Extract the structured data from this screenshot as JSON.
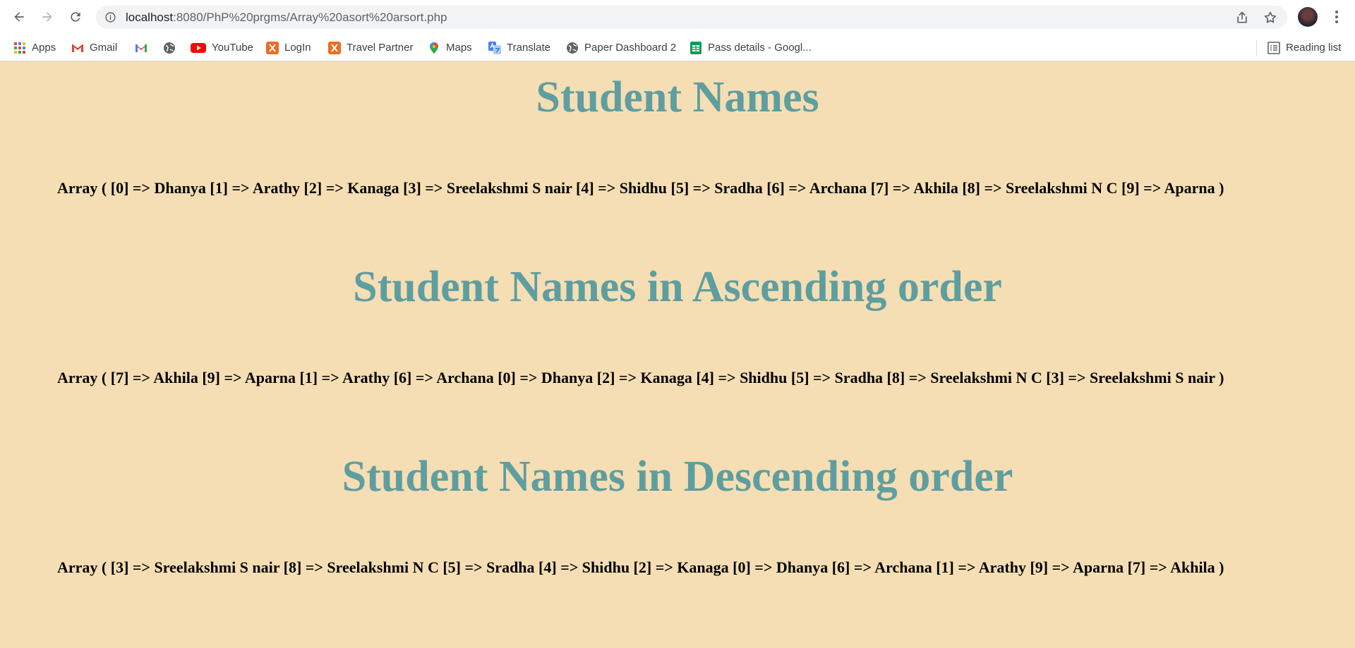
{
  "browser": {
    "url_host": "localhost",
    "url_rest": ":8080/PhP%20prgms/Array%20asort%20arsort.php",
    "bookmarks": [
      {
        "label": "Apps",
        "icon": "apps-grid-icon"
      },
      {
        "label": "Gmail",
        "icon": "gmail-icon"
      },
      {
        "label": "",
        "icon": "gmail-icon"
      },
      {
        "label": "",
        "icon": "globe-icon"
      },
      {
        "label": "YouTube",
        "icon": "youtube-icon"
      },
      {
        "label": "LogIn",
        "icon": "xampp-icon"
      },
      {
        "label": "Travel Partner",
        "icon": "xampp-icon"
      },
      {
        "label": "Maps",
        "icon": "maps-pin-icon"
      },
      {
        "label": "Translate",
        "icon": "translate-icon"
      },
      {
        "label": "Paper Dashboard 2",
        "icon": "globe-icon"
      },
      {
        "label": "Pass details - Googl...",
        "icon": "sheets-icon"
      }
    ],
    "reading_list": "Reading list"
  },
  "content": {
    "heading1": "Student Names",
    "array1": "Array ( [0] => Dhanya [1] => Arathy [2] => Kanaga [3] => Sreelakshmi S nair [4] => Shidhu [5] => Sradha [6] => Archana [7] => Akhila [8] => Sreelakshmi N C [9] => Aparna )",
    "heading2": "Student Names in Ascending order",
    "array2": "Array ( [7] => Akhila [9] => Aparna [1] => Arathy [6] => Archana [0] => Dhanya [2] => Kanaga [4] => Shidhu [5] => Sradha [8] => Sreelakshmi N C [3] => Sreelakshmi S nair )",
    "heading3": "Student Names in Descending order",
    "array3": "Array ( [3] => Sreelakshmi S nair [8] => Sreelakshmi N C [5] => Sradha [4] => Shidhu [2] => Kanaga [0] => Dhanya [6] => Archana [1] => Arathy [9] => Aparna [7] => Akhila )"
  },
  "colors": {
    "page_background": "#f5deb3",
    "heading": "#5f9ea0",
    "text": "#000000"
  }
}
